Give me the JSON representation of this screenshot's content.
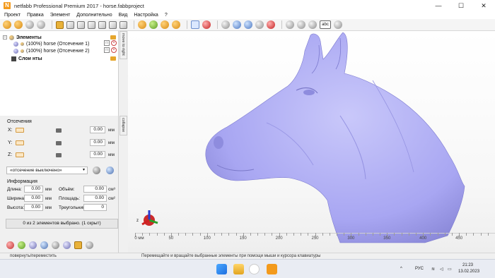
{
  "window": {
    "app_icon_letter": "N",
    "title": "netfabb Professional Premium 2017 - horse.fabbproject",
    "minimize": "—",
    "maximize": "☐",
    "close": "✕"
  },
  "menu": [
    "Проект",
    "Правка",
    "Элемент",
    "Дополнительно",
    "Вид",
    "Настройка",
    "?"
  ],
  "toolbar": {
    "abc_label": "abc"
  },
  "tree": {
    "parts_label": "Элементы",
    "items": [
      {
        "label": "(100%) horse (Отсечение 1)",
        "box": "□",
        "del": "×"
      },
      {
        "label": "(100%) horse (Отсечение 2)",
        "box": "□",
        "del": "×"
      }
    ],
    "layers_label": "Слои нты",
    "expander": "−"
  },
  "side_tabs": {
    "move_to_right": "move to right",
    "collapse": "collapse"
  },
  "cuts": {
    "title": "Отсечения",
    "axes": [
      {
        "label": "X:",
        "value": "0.00",
        "unit": "мм"
      },
      {
        "label": "Y:",
        "value": "0.00",
        "unit": "мм"
      },
      {
        "label": "Z:",
        "value": "0.00",
        "unit": "мм"
      }
    ],
    "mode_select": "«отсечение выключено»",
    "select_arrow": "▾"
  },
  "info": {
    "title": "Информация",
    "length_label": "Длина:",
    "length_value": "0.00",
    "length_unit": "мм",
    "width_label": "Ширина:",
    "width_value": "0.00",
    "width_unit": "мм",
    "height_label": "Высота:",
    "height_value": "0.00",
    "height_unit": "мм",
    "volume_label": "Объём:",
    "volume_value": "0.00",
    "volume_unit": "см³",
    "area_label": "Площадь:",
    "area_value": "0.00",
    "area_unit": "см²",
    "triangles_label": "Треугольники",
    "triangles_value": "0"
  },
  "selection_status": "0 из 2 элементов выбрано. (1 скрыт)",
  "ruler": {
    "labels": [
      "0 мм",
      "50",
      "100",
      "150",
      "200",
      "250",
      "300",
      "350",
      "400",
      "450"
    ],
    "values": [
      0,
      50,
      100,
      150,
      200,
      250,
      300,
      350,
      400,
      450
    ],
    "max": 500
  },
  "axis_gizmo_z": "z",
  "statusbar": {
    "left": "повернуть/переместить",
    "center": "Перемещайте и вращайте выбранные элементы при помощи мыши и курсора клавиатуры"
  },
  "taskbar": {
    "lang": "РУС",
    "time": "21:23",
    "date": "13.02.2023"
  },
  "colors": {
    "model": "#a8a6f2",
    "accent": "#e9b23a"
  }
}
